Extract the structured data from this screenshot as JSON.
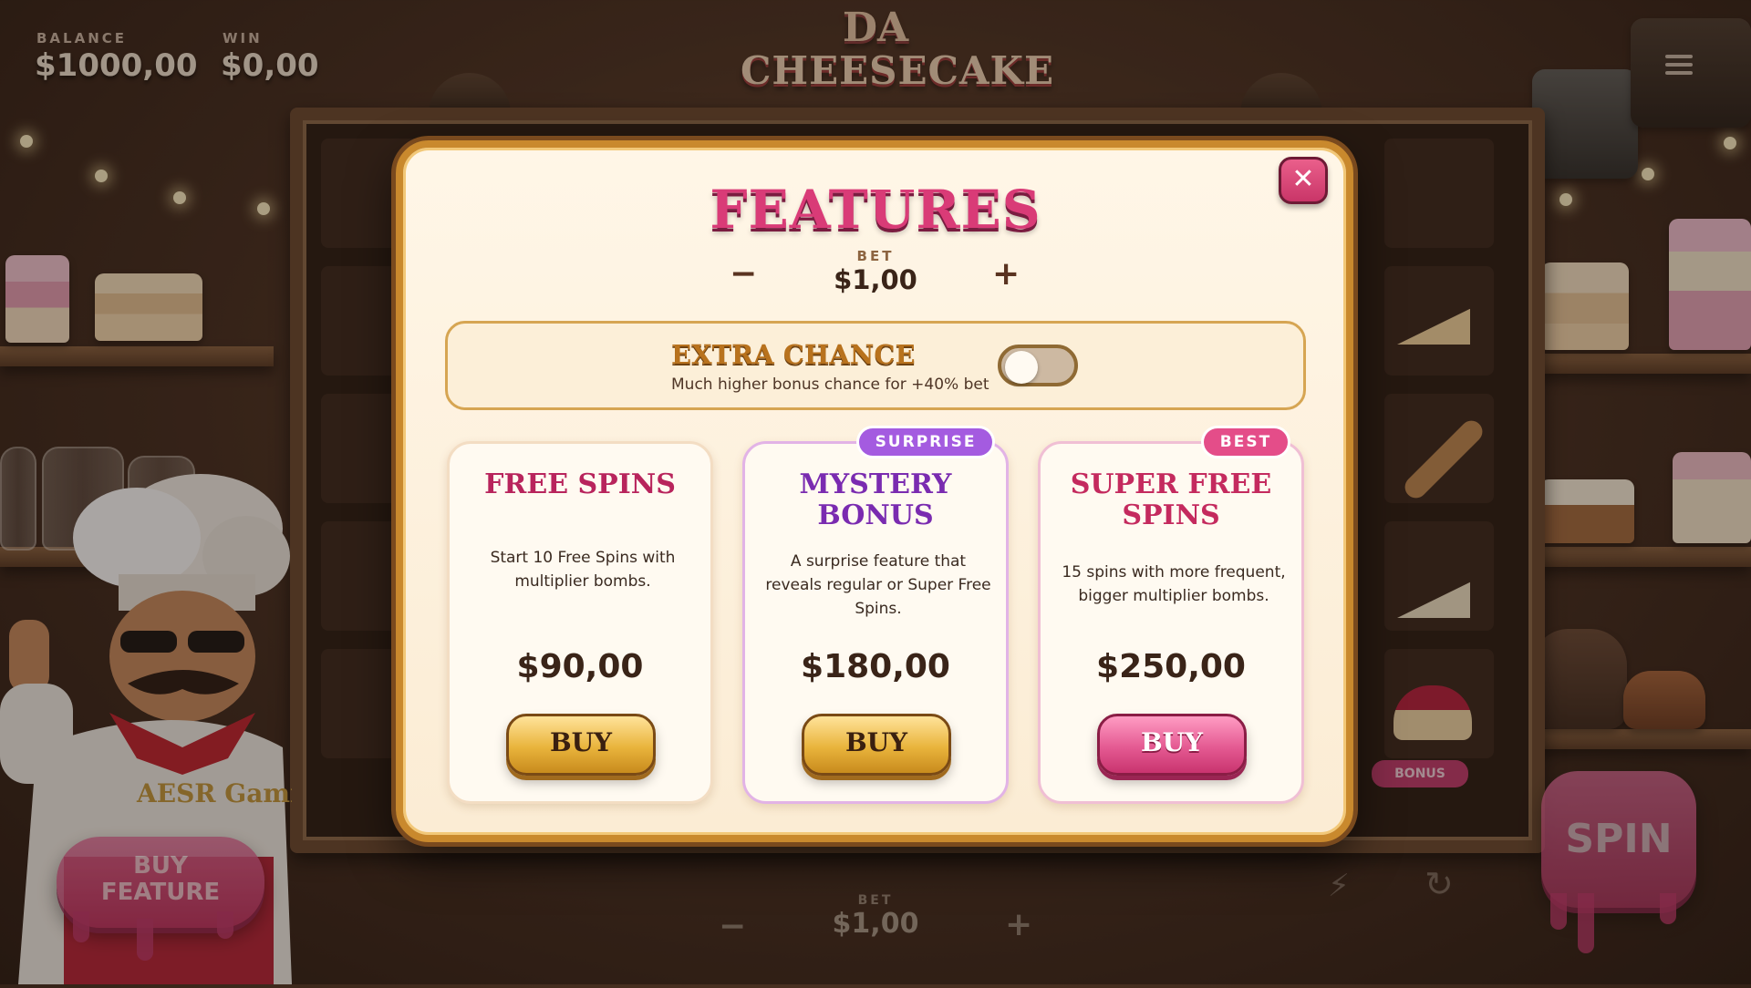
{
  "hud": {
    "balance_label": "BALANCE",
    "balance_value": "$1000,00",
    "win_label": "WIN",
    "win_value": "$0,00"
  },
  "logo": {
    "line1": "DA",
    "line2": "CHEESECAKE"
  },
  "chef_badge": "AESR Gaming",
  "bonus_tag": "BONUS",
  "buy_feature_button": "BUY FEATURE",
  "spin_button": "SPIN",
  "bottom_bar": {
    "bet_label": "BET",
    "bet_value": "$1,00",
    "minus": "−",
    "plus": "+"
  },
  "modal": {
    "title": "FEATURES",
    "bet_label": "BET",
    "bet_value": "$1,00",
    "minus": "−",
    "plus": "+",
    "close": "✕",
    "extra_chance": {
      "title": "EXTRA CHANCE",
      "subtitle": "Much higher bonus chance for +40% bet",
      "enabled": false
    },
    "cards": [
      {
        "title_line1": "FREE SPINS",
        "title_line2": "",
        "description": "Start 10 Free Spins with multiplier bombs.",
        "price": "$90,00",
        "buy": "BUY",
        "badge": "",
        "title_color": "#b8245c"
      },
      {
        "title_line1": "MYSTERY",
        "title_line2": "BONUS",
        "description": "A surprise feature that reveals regular or Super Free Spins.",
        "price": "$180,00",
        "buy": "BUY",
        "badge": "SURPRISE",
        "title_color": "#7a2bb0"
      },
      {
        "title_line1": "SUPER FREE",
        "title_line2": "SPINS",
        "description": "15 spins with more frequent, bigger multiplier bombs.",
        "price": "$250,00",
        "buy": "BUY",
        "badge": "BEST",
        "title_color": "#c42a5e"
      }
    ]
  },
  "icons": [
    "menu-icon",
    "close-icon",
    "lightning-icon",
    "refresh-icon"
  ]
}
